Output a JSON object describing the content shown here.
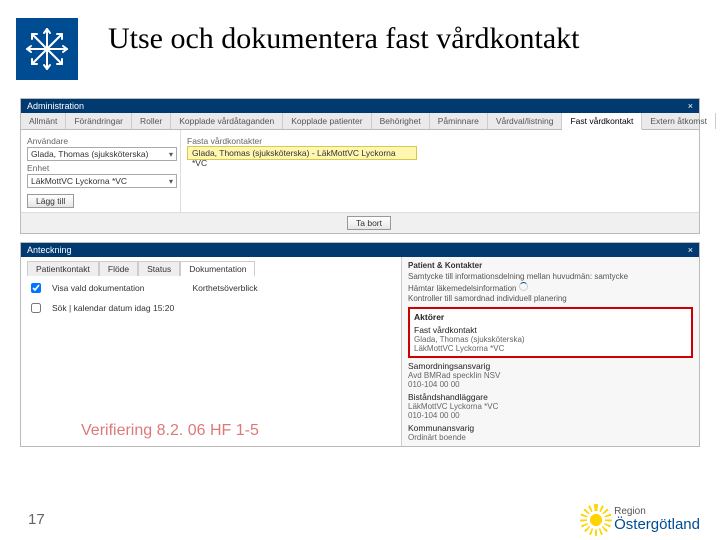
{
  "slide": {
    "title": "Utse och dokumentera fast vårdkontakt",
    "number": "17"
  },
  "footer": {
    "region_small": "Region",
    "region_name": "Östergötland"
  },
  "panel1": {
    "winbar_left": "Administration",
    "winbar_right": "×",
    "tabs": [
      "Allmänt",
      "Förändringar",
      "Roller",
      "Kopplade vårdåtaganden",
      "Kopplade patienter",
      "Behörighet",
      "Påminnare",
      "Vårdval/listning",
      "Fast vårdkontakt",
      "Extern åtkomst"
    ],
    "active_tab_index": 8,
    "left": {
      "anvandare_label": "Användare",
      "anvandare_value": "Glada, Thomas (sjuksköterska)",
      "enhet_label": "Enhet",
      "enhet_value": "LäkMottVC Lyckorna *VC",
      "lagg_till": "Lägg till"
    },
    "mid": {
      "fasta_label": "Fasta vårdkontakter",
      "yellow_text": "Glada, Thomas (sjuksköterska) - LäkMottVC Lyckorna *VC"
    },
    "ta_bort": "Ta bort"
  },
  "panel2": {
    "winbar_left": "Anteckning",
    "winbar_right": "×",
    "tabs": [
      "Patientkontakt",
      "Flöde",
      "Status",
      "Dokumentation"
    ],
    "active_tab_index": 3,
    "check1": "Visa vald dokumentation",
    "kort1": "Korthetsöverblick",
    "date_line": "Sök  | kalendar datum   idag 15:20",
    "watermark": "Verifiering 8.2. 06 HF 1-5",
    "right": {
      "header": "Patient & Kontakter",
      "law": "Samtycke till informationsdelning mellan huvudmän: samtycke",
      "loading1": "Hämtar läkemedelsinformation",
      "loading2": "Kontroller till samordnad individuell planering",
      "aktorer": "Aktörer",
      "fvk_label": "Fast vårdkontakt",
      "fvk_name": "Glada, Thomas (sjuksköterska)",
      "fvk_enhet": "LäkMottVC Lyckorna *VC",
      "samord_label": "Samordningsansvarig",
      "samord_value": "Avd BMRad specklin NSV",
      "samord_tel": "010-104 00 00",
      "bitr_label": "Biståndshandläggare",
      "bitr_value": "LäkMottVC Lyckorna *VC",
      "bitr_tel": "010-104 00 00",
      "kommun_label": "Kommunansvarig",
      "kommun_value": "Ordinärt boende"
    }
  }
}
